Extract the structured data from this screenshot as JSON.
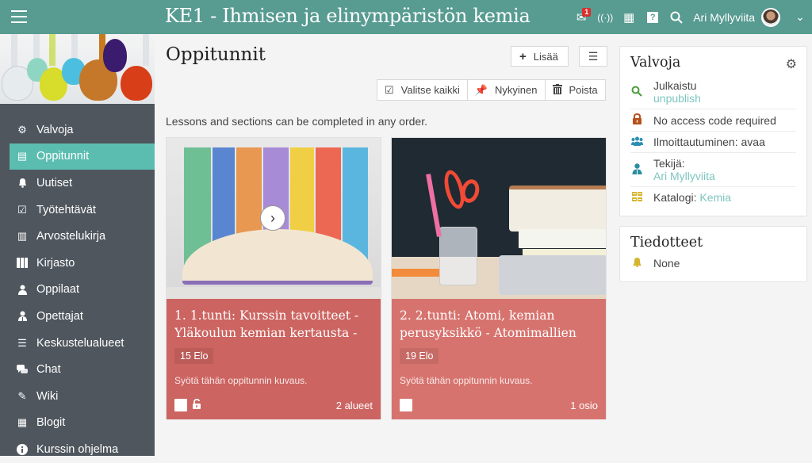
{
  "header": {
    "title": "KE1 - Ihmisen ja elinympäristön kemia",
    "notification_count": "1",
    "user_name": "Ari Myllyviita",
    "icons": [
      "mail-icon",
      "broadcast-icon",
      "calendar-icon",
      "help-icon",
      "search-icon"
    ]
  },
  "sidebar": {
    "items": [
      {
        "label": "Valvoja",
        "icon": "gear-icon",
        "glyph": "⚙"
      },
      {
        "label": "Oppitunnit",
        "icon": "lessons-icon",
        "glyph": "▤",
        "active": true
      },
      {
        "label": "Uutiset",
        "icon": "bell-icon",
        "glyph": "🔔"
      },
      {
        "label": "Työtehtävät",
        "icon": "checkbox-icon",
        "glyph": "☑"
      },
      {
        "label": "Arvostelukirja",
        "icon": "gradebook-icon",
        "glyph": "▥"
      },
      {
        "label": "Kirjasto",
        "icon": "library-icon",
        "glyph": "▮"
      },
      {
        "label": "Oppilaat",
        "icon": "student-icon",
        "glyph": "●"
      },
      {
        "label": "Opettajat",
        "icon": "teacher-icon",
        "glyph": "●"
      },
      {
        "label": "Keskustelualueet",
        "icon": "forum-icon",
        "glyph": "☰"
      },
      {
        "label": "Chat",
        "icon": "chat-icon",
        "glyph": "💬"
      },
      {
        "label": "Wiki",
        "icon": "wiki-icon",
        "glyph": "✎"
      },
      {
        "label": "Blogit",
        "icon": "blog-icon",
        "glyph": "▦"
      },
      {
        "label": "Kurssin ohjelma",
        "icon": "info-icon",
        "glyph": "ℹ"
      }
    ]
  },
  "main": {
    "title": "Oppitunnit",
    "add_label": "Lisää",
    "select_all_label": "Valitse kaikki",
    "current_label": "Nykyinen",
    "delete_label": "Poista",
    "info": "Lessons and sections can be completed in any order.",
    "cards": [
      {
        "title": "1. 1.tunti: Kurssin tavoitteet - Yläkoulun kemian kertausta -",
        "date": "15 Elo",
        "description": "Syötä tähän oppitunnin kuvaus.",
        "count": "2 alueet",
        "color": "#cc6461"
      },
      {
        "title": "2. 2.tunti: Atomi, kemian perusyksikkö - Atomimallien",
        "date": "19 Elo",
        "description": "Syötä tähän oppitunnin kuvaus.",
        "count": "1 osio",
        "color": "#d7736e"
      }
    ]
  },
  "valvoja": {
    "title": "Valvoja",
    "published_label": "Julkaistu",
    "unpublish_link": "unpublish",
    "access": "No access code required",
    "enrollment": "Ilmoittautuminen: avaa",
    "author_label": "Tekijä:",
    "author": "Ari Myllyviita",
    "catalog_label": "Katalogi: ",
    "catalog": "Kemia",
    "colors": {
      "search": "#4a9a3a",
      "lock": "#b8501e",
      "users": "#2b8fb5",
      "author": "#2b8fa0",
      "catalog": "#d6b52e"
    }
  },
  "tiedotteet": {
    "title": "Tiedotteet",
    "value": "None"
  }
}
